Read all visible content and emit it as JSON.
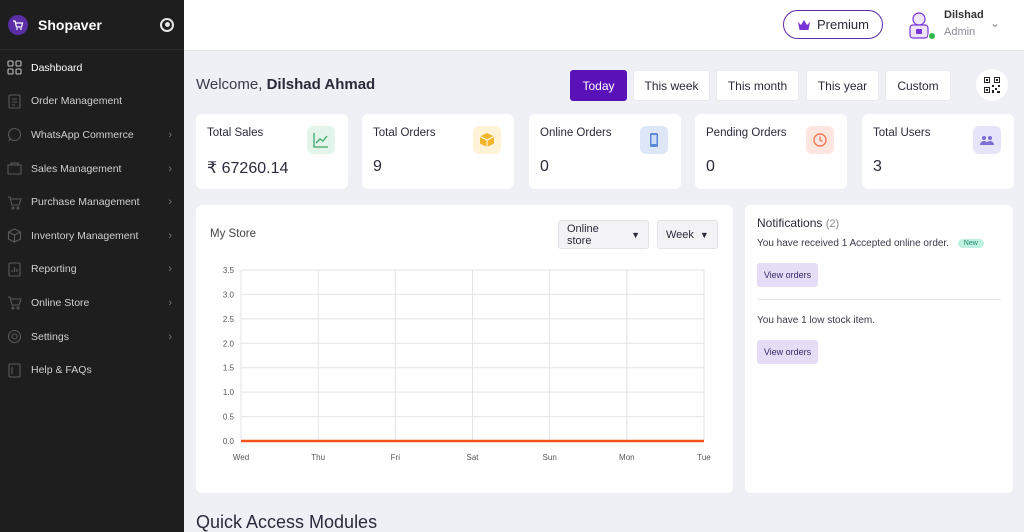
{
  "brand": {
    "name": "Shopaver"
  },
  "sidebar": {
    "items": [
      {
        "label": "Dashboard",
        "icon": "dashboard-icon",
        "active": true
      },
      {
        "label": "Order Management",
        "icon": "orders-icon"
      },
      {
        "label": "WhatsApp Commerce",
        "icon": "whatsapp-icon"
      },
      {
        "label": "Sales Management",
        "icon": "sales-icon"
      },
      {
        "label": "Purchase Management",
        "icon": "purchase-icon"
      },
      {
        "label": "Inventory Management",
        "icon": "inventory-icon"
      },
      {
        "label": "Reporting",
        "icon": "reporting-icon"
      },
      {
        "label": "Online Store",
        "icon": "store-icon"
      },
      {
        "label": "Settings",
        "icon": "settings-icon"
      },
      {
        "label": "Help & FAQs",
        "icon": "help-icon"
      }
    ]
  },
  "header": {
    "premium_label": "Premium",
    "user_name": "Dilshad",
    "user_role": "Admin"
  },
  "welcome": {
    "prefix": "Welcome,",
    "name": "Dilshad Ahmad"
  },
  "filters": [
    "Today",
    "This week",
    "This month",
    "This year",
    "Custom"
  ],
  "filters_active": "Today",
  "stats": [
    {
      "title": "Total Sales",
      "value": "₹ 67260.14",
      "icon": "chart-line-icon",
      "color": "#e3f5ea"
    },
    {
      "title": "Total Orders",
      "value": "9",
      "icon": "box-icon",
      "color": "#fff2d6"
    },
    {
      "title": "Online Orders",
      "value": "0",
      "icon": "mobile-icon",
      "color": "#dde7f7"
    },
    {
      "title": "Pending Orders",
      "value": "0",
      "icon": "clock-icon",
      "color": "#fde6df"
    },
    {
      "title": "Total Users",
      "value": "3",
      "icon": "users-icon",
      "color": "#e6e4f8"
    }
  ],
  "store_chart": {
    "title": "My Store",
    "store_select": "Online store",
    "period_select": "Week"
  },
  "chart_data": {
    "type": "line",
    "categories": [
      "Wed",
      "Thu",
      "Fri",
      "Sat",
      "Sun",
      "Mon",
      "Tue"
    ],
    "y_ticks": [
      "0.0",
      "0.5",
      "1.0",
      "1.5",
      "2.0",
      "2.5",
      "3.0",
      "3.5"
    ],
    "series": [
      {
        "values": [
          0,
          0,
          0,
          0,
          0,
          0,
          0
        ],
        "color": "#f2541b"
      }
    ],
    "ylim": [
      0,
      3.5
    ],
    "grid": true
  },
  "notifications": {
    "title": "Notifications",
    "count": "(2)",
    "items": [
      {
        "text": "You have received 1 Accepted online order.",
        "badge": "New",
        "button": "View orders"
      },
      {
        "text": "You have 1 low stock item.",
        "button": "View orders"
      }
    ]
  },
  "quick_access": {
    "title": "Quick Access Modules"
  },
  "colors": {
    "accent": "#5a11b8",
    "sidebar": "#1e1e1e"
  }
}
